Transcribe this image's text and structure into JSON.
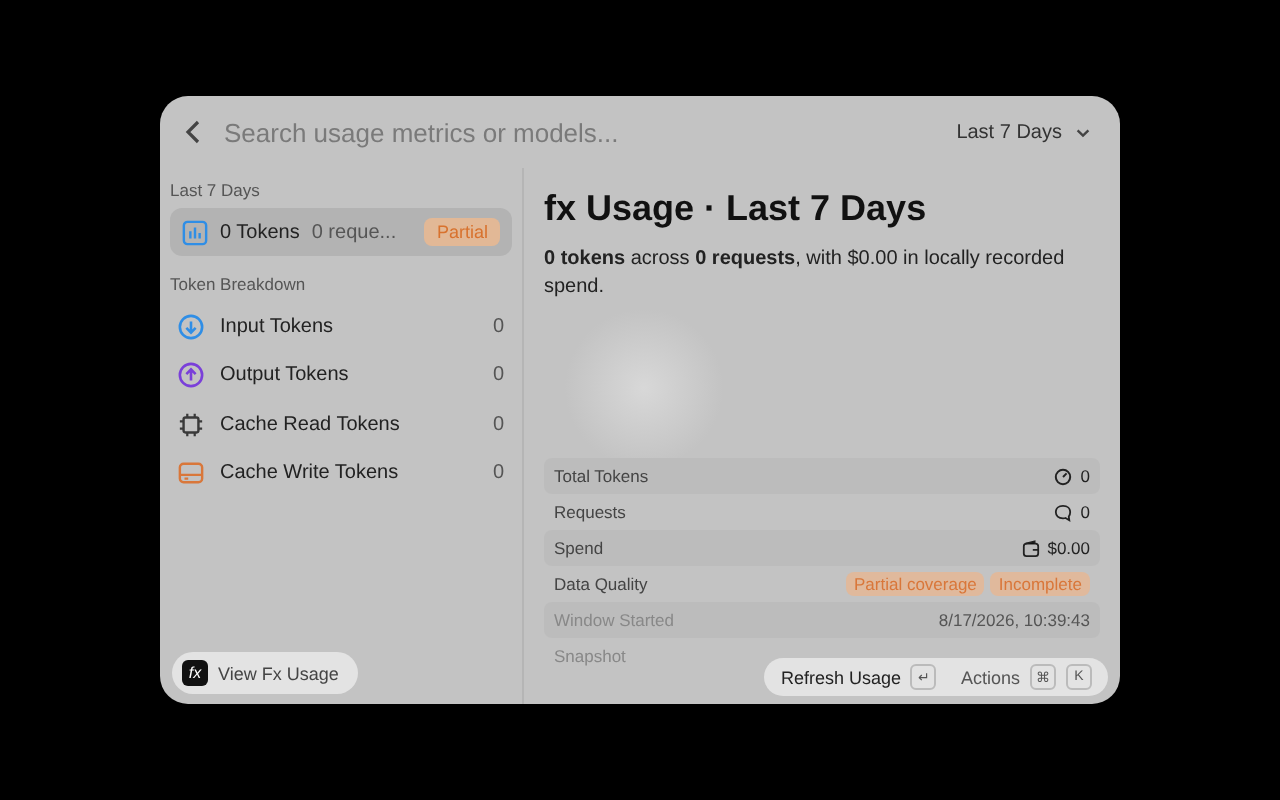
{
  "search": {
    "placeholder": "Search usage metrics or models..."
  },
  "range": {
    "label": "Last 7 Days"
  },
  "sidebar": {
    "section": "Last 7 Days",
    "summary": {
      "tokens": "0 Tokens",
      "requests": "0 reque...",
      "badge": "Partial",
      "selected": true
    },
    "breakdown_title": "Token Breakdown",
    "items": [
      {
        "kind": "input",
        "label": "Input Tokens",
        "value": "0",
        "color": "#2f8ee6"
      },
      {
        "kind": "output",
        "label": "Output Tokens",
        "value": "0",
        "color": "#7a3fd9"
      },
      {
        "kind": "cache_read",
        "label": "Cache Read Tokens",
        "value": "0",
        "color": "#3a3a3a"
      },
      {
        "kind": "cache_write",
        "label": "Cache Write Tokens",
        "value": "0",
        "color": "#d9773a"
      }
    ]
  },
  "detail": {
    "title": "fx Usage · Last 7 Days",
    "summary": "**0 tokens** across **0 requests**, with $0.00 in locally recorded spend.",
    "rows": [
      {
        "kind": "tokens",
        "label": "Total Tokens",
        "value": "0",
        "dimmed": false
      },
      {
        "kind": "requests",
        "label": "Requests",
        "value": "0",
        "dimmed": false
      },
      {
        "kind": "spend",
        "label": "Spend",
        "value": "$0.00",
        "dimmed": false
      },
      {
        "kind": "badges",
        "label": "Data Quality",
        "badges": [
          "Partial coverage",
          "Incomplete"
        ],
        "dimmed": false
      },
      {
        "kind": "value",
        "label": "Window Started",
        "value": "8/17/2026, 10:39:43",
        "dimmed": true
      },
      {
        "kind": "value",
        "label": "Snapshot",
        "dimmed": true
      }
    ]
  },
  "footer": {
    "view_label": "View Fx Usage",
    "app_icon": "fx",
    "primary": "Refresh Usage",
    "primary_key": "↵",
    "actions": "Actions",
    "action_keys": [
      "⌘",
      "K"
    ]
  }
}
